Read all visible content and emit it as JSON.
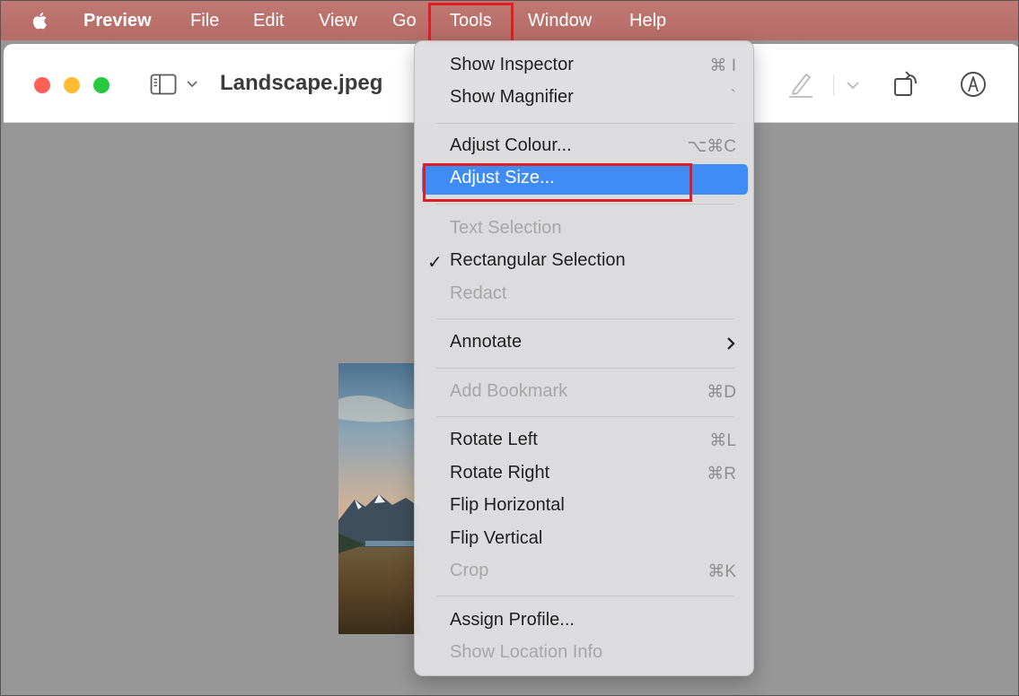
{
  "menubar": {
    "apple_icon": "apple-logo-icon",
    "items": [
      {
        "label": "Preview",
        "bold": true
      },
      {
        "label": "File"
      },
      {
        "label": "Edit"
      },
      {
        "label": "View"
      },
      {
        "label": "Go"
      },
      {
        "label": "Tools",
        "open": true
      },
      {
        "label": "Window"
      },
      {
        "label": "Help"
      }
    ]
  },
  "window": {
    "title": "Landscape.jpeg",
    "toolbar_icons": [
      "sidebar-toggle-icon",
      "chevron-down-icon",
      "pencil-markup-icon",
      "chevron-down-icon",
      "rotate-icon",
      "markup-pen-circle-icon"
    ]
  },
  "tools_menu": {
    "items": [
      {
        "label": "Show Inspector",
        "shortcut": "⌘ I",
        "enabled": true
      },
      {
        "label": "Show Magnifier",
        "shortcut": "`",
        "enabled": true
      },
      {
        "label": "Adjust Colour...",
        "shortcut": "⌥⌘C",
        "enabled": true
      },
      {
        "label": "Adjust Size...",
        "shortcut": "",
        "enabled": true,
        "highlighted": true
      },
      {
        "label": "Text Selection",
        "shortcut": "",
        "enabled": false
      },
      {
        "label": "Rectangular Selection",
        "shortcut": "",
        "enabled": true,
        "checked": true
      },
      {
        "label": "Redact",
        "shortcut": "",
        "enabled": false
      },
      {
        "label": "Annotate",
        "shortcut": "",
        "enabled": true,
        "submenu": true
      },
      {
        "label": "Add Bookmark",
        "shortcut": "⌘D",
        "enabled": false
      },
      {
        "label": "Rotate Left",
        "shortcut": "⌘L",
        "enabled": true
      },
      {
        "label": "Rotate Right",
        "shortcut": "⌘R",
        "enabled": true
      },
      {
        "label": "Flip Horizontal",
        "shortcut": "",
        "enabled": true
      },
      {
        "label": "Flip Vertical",
        "shortcut": "",
        "enabled": true
      },
      {
        "label": "Crop",
        "shortcut": "⌘K",
        "enabled": false
      },
      {
        "label": "Assign Profile...",
        "shortcut": "",
        "enabled": true
      },
      {
        "label": "Show Location Info",
        "shortcut": "",
        "enabled": false
      }
    ]
  },
  "colors": {
    "menubar": "#b56b66",
    "selection": "#3f8cf4",
    "annotation_box": "#e01e26",
    "canvas": "#979797"
  }
}
